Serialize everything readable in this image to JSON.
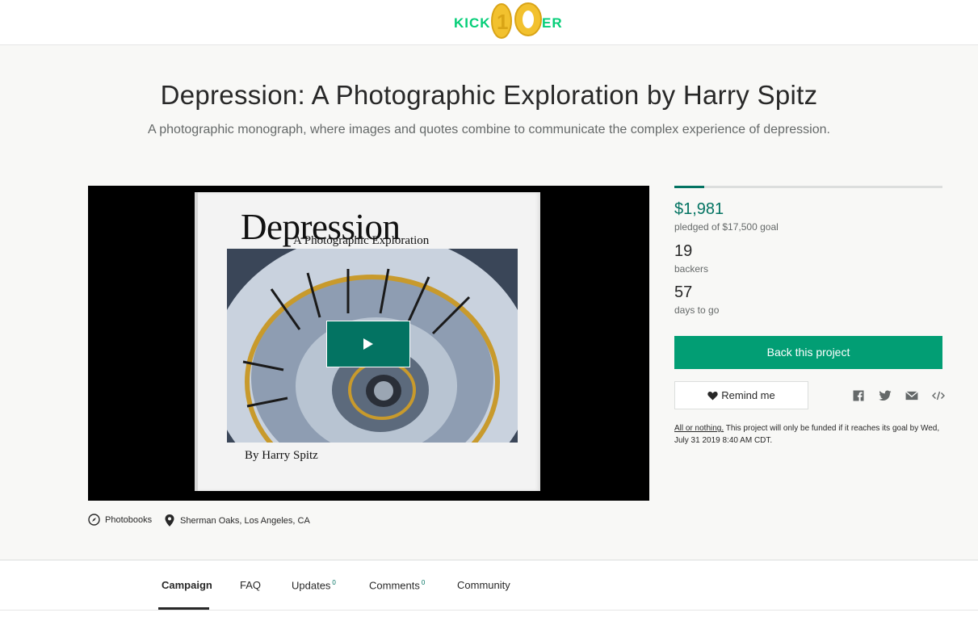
{
  "header": {
    "logo_text": "KICKSTARTER",
    "logo_color": "#05ce78"
  },
  "project": {
    "title": "Depression: A Photographic Exploration by Harry Spitz",
    "blurb": "A photographic monograph, where images and quotes combine to communicate the complex experience of depression."
  },
  "video": {
    "book_title": "Depression",
    "book_subtitle": "A Photographic Exploration",
    "book_author": "By Harry Spitz",
    "play_icon": "play-icon"
  },
  "meta": {
    "category": "Photobooks",
    "category_icon": "compass-icon",
    "location": "Sherman Oaks, Los Angeles, CA",
    "location_icon": "location-pin-icon"
  },
  "stats": {
    "funded_fraction": 0.11,
    "pledged": "$1,981",
    "pledged_label": "pledged of $17,500 goal",
    "backers": "19",
    "backers_label": "backers",
    "days": "57",
    "days_label": "days to go"
  },
  "actions": {
    "back_label": "Back this project",
    "remind_label": "Remind me",
    "remind_icon": "heart-icon",
    "share_icons": [
      "facebook-icon",
      "twitter-icon",
      "email-icon",
      "embed-icon"
    ]
  },
  "fine_print": {
    "link": "All or nothing.",
    "text": " This project will only be funded if it reaches its goal by Wed, July 31 2019 8:40 AM CDT."
  },
  "tabs": [
    {
      "label": "Campaign",
      "count": ""
    },
    {
      "label": "FAQ",
      "count": ""
    },
    {
      "label": "Updates",
      "count": "0"
    },
    {
      "label": "Comments",
      "count": "0"
    },
    {
      "label": "Community",
      "count": ""
    }
  ],
  "colors": {
    "accent": "#037362",
    "button": "#029e74",
    "background": "#f8f8f6"
  }
}
